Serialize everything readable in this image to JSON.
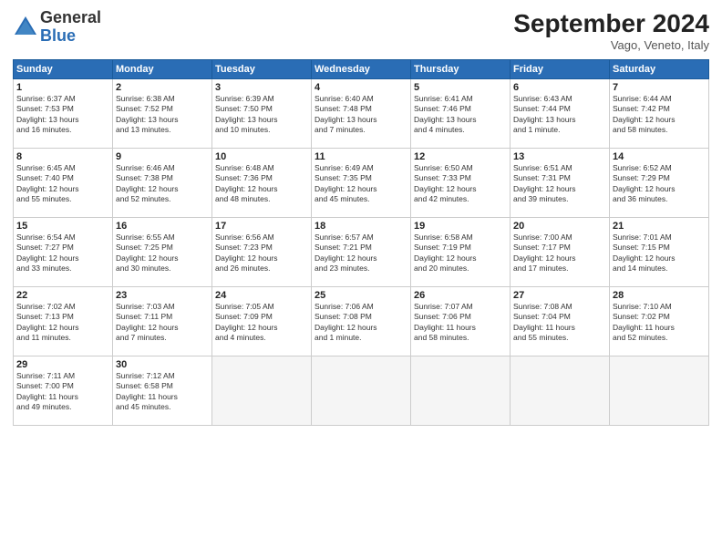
{
  "logo": {
    "general": "General",
    "blue": "Blue"
  },
  "header": {
    "title": "September 2024",
    "location": "Vago, Veneto, Italy"
  },
  "weekdays": [
    "Sunday",
    "Monday",
    "Tuesday",
    "Wednesday",
    "Thursday",
    "Friday",
    "Saturday"
  ],
  "weeks": [
    [
      {
        "day": "1",
        "lines": [
          "Sunrise: 6:37 AM",
          "Sunset: 7:53 PM",
          "Daylight: 13 hours",
          "and 16 minutes."
        ]
      },
      {
        "day": "2",
        "lines": [
          "Sunrise: 6:38 AM",
          "Sunset: 7:52 PM",
          "Daylight: 13 hours",
          "and 13 minutes."
        ]
      },
      {
        "day": "3",
        "lines": [
          "Sunrise: 6:39 AM",
          "Sunset: 7:50 PM",
          "Daylight: 13 hours",
          "and 10 minutes."
        ]
      },
      {
        "day": "4",
        "lines": [
          "Sunrise: 6:40 AM",
          "Sunset: 7:48 PM",
          "Daylight: 13 hours",
          "and 7 minutes."
        ]
      },
      {
        "day": "5",
        "lines": [
          "Sunrise: 6:41 AM",
          "Sunset: 7:46 PM",
          "Daylight: 13 hours",
          "and 4 minutes."
        ]
      },
      {
        "day": "6",
        "lines": [
          "Sunrise: 6:43 AM",
          "Sunset: 7:44 PM",
          "Daylight: 13 hours",
          "and 1 minute."
        ]
      },
      {
        "day": "7",
        "lines": [
          "Sunrise: 6:44 AM",
          "Sunset: 7:42 PM",
          "Daylight: 12 hours",
          "and 58 minutes."
        ]
      }
    ],
    [
      {
        "day": "8",
        "lines": [
          "Sunrise: 6:45 AM",
          "Sunset: 7:40 PM",
          "Daylight: 12 hours",
          "and 55 minutes."
        ]
      },
      {
        "day": "9",
        "lines": [
          "Sunrise: 6:46 AM",
          "Sunset: 7:38 PM",
          "Daylight: 12 hours",
          "and 52 minutes."
        ]
      },
      {
        "day": "10",
        "lines": [
          "Sunrise: 6:48 AM",
          "Sunset: 7:36 PM",
          "Daylight: 12 hours",
          "and 48 minutes."
        ]
      },
      {
        "day": "11",
        "lines": [
          "Sunrise: 6:49 AM",
          "Sunset: 7:35 PM",
          "Daylight: 12 hours",
          "and 45 minutes."
        ]
      },
      {
        "day": "12",
        "lines": [
          "Sunrise: 6:50 AM",
          "Sunset: 7:33 PM",
          "Daylight: 12 hours",
          "and 42 minutes."
        ]
      },
      {
        "day": "13",
        "lines": [
          "Sunrise: 6:51 AM",
          "Sunset: 7:31 PM",
          "Daylight: 12 hours",
          "and 39 minutes."
        ]
      },
      {
        "day": "14",
        "lines": [
          "Sunrise: 6:52 AM",
          "Sunset: 7:29 PM",
          "Daylight: 12 hours",
          "and 36 minutes."
        ]
      }
    ],
    [
      {
        "day": "15",
        "lines": [
          "Sunrise: 6:54 AM",
          "Sunset: 7:27 PM",
          "Daylight: 12 hours",
          "and 33 minutes."
        ]
      },
      {
        "day": "16",
        "lines": [
          "Sunrise: 6:55 AM",
          "Sunset: 7:25 PM",
          "Daylight: 12 hours",
          "and 30 minutes."
        ]
      },
      {
        "day": "17",
        "lines": [
          "Sunrise: 6:56 AM",
          "Sunset: 7:23 PM",
          "Daylight: 12 hours",
          "and 26 minutes."
        ]
      },
      {
        "day": "18",
        "lines": [
          "Sunrise: 6:57 AM",
          "Sunset: 7:21 PM",
          "Daylight: 12 hours",
          "and 23 minutes."
        ]
      },
      {
        "day": "19",
        "lines": [
          "Sunrise: 6:58 AM",
          "Sunset: 7:19 PM",
          "Daylight: 12 hours",
          "and 20 minutes."
        ]
      },
      {
        "day": "20",
        "lines": [
          "Sunrise: 7:00 AM",
          "Sunset: 7:17 PM",
          "Daylight: 12 hours",
          "and 17 minutes."
        ]
      },
      {
        "day": "21",
        "lines": [
          "Sunrise: 7:01 AM",
          "Sunset: 7:15 PM",
          "Daylight: 12 hours",
          "and 14 minutes."
        ]
      }
    ],
    [
      {
        "day": "22",
        "lines": [
          "Sunrise: 7:02 AM",
          "Sunset: 7:13 PM",
          "Daylight: 12 hours",
          "and 11 minutes."
        ]
      },
      {
        "day": "23",
        "lines": [
          "Sunrise: 7:03 AM",
          "Sunset: 7:11 PM",
          "Daylight: 12 hours",
          "and 7 minutes."
        ]
      },
      {
        "day": "24",
        "lines": [
          "Sunrise: 7:05 AM",
          "Sunset: 7:09 PM",
          "Daylight: 12 hours",
          "and 4 minutes."
        ]
      },
      {
        "day": "25",
        "lines": [
          "Sunrise: 7:06 AM",
          "Sunset: 7:08 PM",
          "Daylight: 12 hours",
          "and 1 minute."
        ]
      },
      {
        "day": "26",
        "lines": [
          "Sunrise: 7:07 AM",
          "Sunset: 7:06 PM",
          "Daylight: 11 hours",
          "and 58 minutes."
        ]
      },
      {
        "day": "27",
        "lines": [
          "Sunrise: 7:08 AM",
          "Sunset: 7:04 PM",
          "Daylight: 11 hours",
          "and 55 minutes."
        ]
      },
      {
        "day": "28",
        "lines": [
          "Sunrise: 7:10 AM",
          "Sunset: 7:02 PM",
          "Daylight: 11 hours",
          "and 52 minutes."
        ]
      }
    ],
    [
      {
        "day": "29",
        "lines": [
          "Sunrise: 7:11 AM",
          "Sunset: 7:00 PM",
          "Daylight: 11 hours",
          "and 49 minutes."
        ]
      },
      {
        "day": "30",
        "lines": [
          "Sunrise: 7:12 AM",
          "Sunset: 6:58 PM",
          "Daylight: 11 hours",
          "and 45 minutes."
        ]
      },
      {
        "day": "",
        "lines": []
      },
      {
        "day": "",
        "lines": []
      },
      {
        "day": "",
        "lines": []
      },
      {
        "day": "",
        "lines": []
      },
      {
        "day": "",
        "lines": []
      }
    ]
  ]
}
